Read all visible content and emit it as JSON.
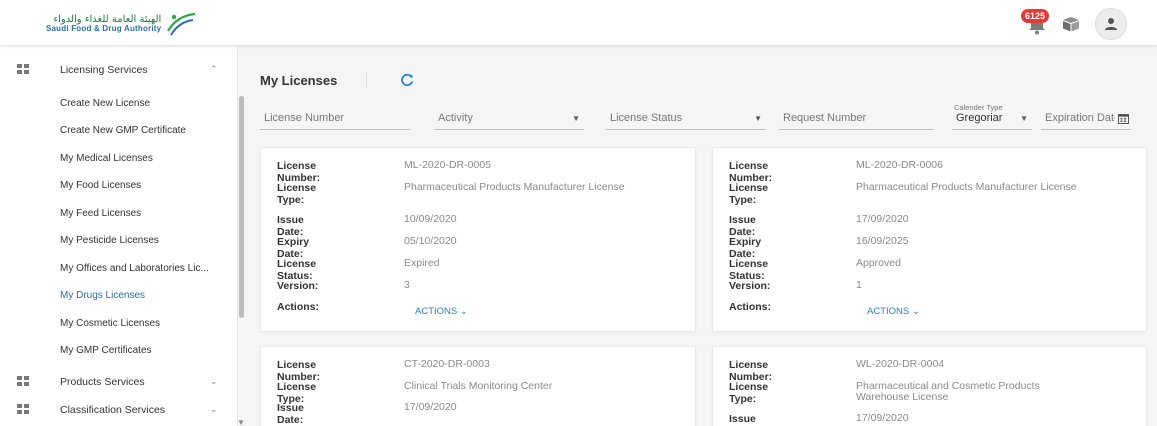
{
  "header": {
    "logo_ar": "الهيئة العامة للغذاء والدواء",
    "logo_en": "Saudi Food & Drug Authority",
    "notification_count": "6125"
  },
  "sidebar": {
    "licensing": {
      "label": "Licensing Services"
    },
    "items": [
      {
        "label": "Create New License"
      },
      {
        "label": "Create New GMP Certificate"
      },
      {
        "label": "My Medical Licenses"
      },
      {
        "label": "My Food Licenses"
      },
      {
        "label": "My Feed Licenses"
      },
      {
        "label": "My Pesticide Licenses"
      },
      {
        "label": "My Offices and Laboratories Lic..."
      },
      {
        "label": "My Drugs Licenses",
        "active": true
      },
      {
        "label": "My Cosmetic Licenses"
      },
      {
        "label": "My GMP Certificates"
      }
    ],
    "products": {
      "label": "Products Services"
    },
    "classification": {
      "label": "Classification Services"
    }
  },
  "main": {
    "title": "My Licenses",
    "filters": {
      "license_number": "License Number",
      "activity": "Activity",
      "license_status": "License Status",
      "request_number": "Request Number",
      "calendar_type_label": "Calender Type",
      "calendar_type_value": "Gregoriar",
      "expiration_date": "Expiration Date"
    },
    "field_labels": {
      "license_number": "License Number:",
      "license_type": "License Type:",
      "issue_date": "Issue Date:",
      "expiry_date": "Expiry Date:",
      "license_status": "License Status:",
      "version": "Version:",
      "actions": "Actions:",
      "actions_button": "ACTIONS"
    },
    "cards": [
      {
        "license_number": "ML-2020-DR-0005",
        "license_type": "Pharmaceutical Products Manufacturer License",
        "issue_date": "10/09/2020",
        "expiry_date": "05/10/2020",
        "license_status": "Expired",
        "version": "3"
      },
      {
        "license_number": "ML-2020-DR-0006",
        "license_type": "Pharmaceutical Products Manufacturer License",
        "issue_date": "17/09/2020",
        "expiry_date": "16/09/2025",
        "license_status": "Approved",
        "version": "1"
      },
      {
        "license_number": "CT-2020-DR-0003",
        "license_type": "Clinical Trials Monitoring Center",
        "issue_date": "17/09/2020"
      },
      {
        "license_number": "WL-2020-DR-0004",
        "license_type": "Pharmaceutical and Cosmetic Products Warehouse License",
        "issue_date": "17/09/2020"
      }
    ]
  }
}
